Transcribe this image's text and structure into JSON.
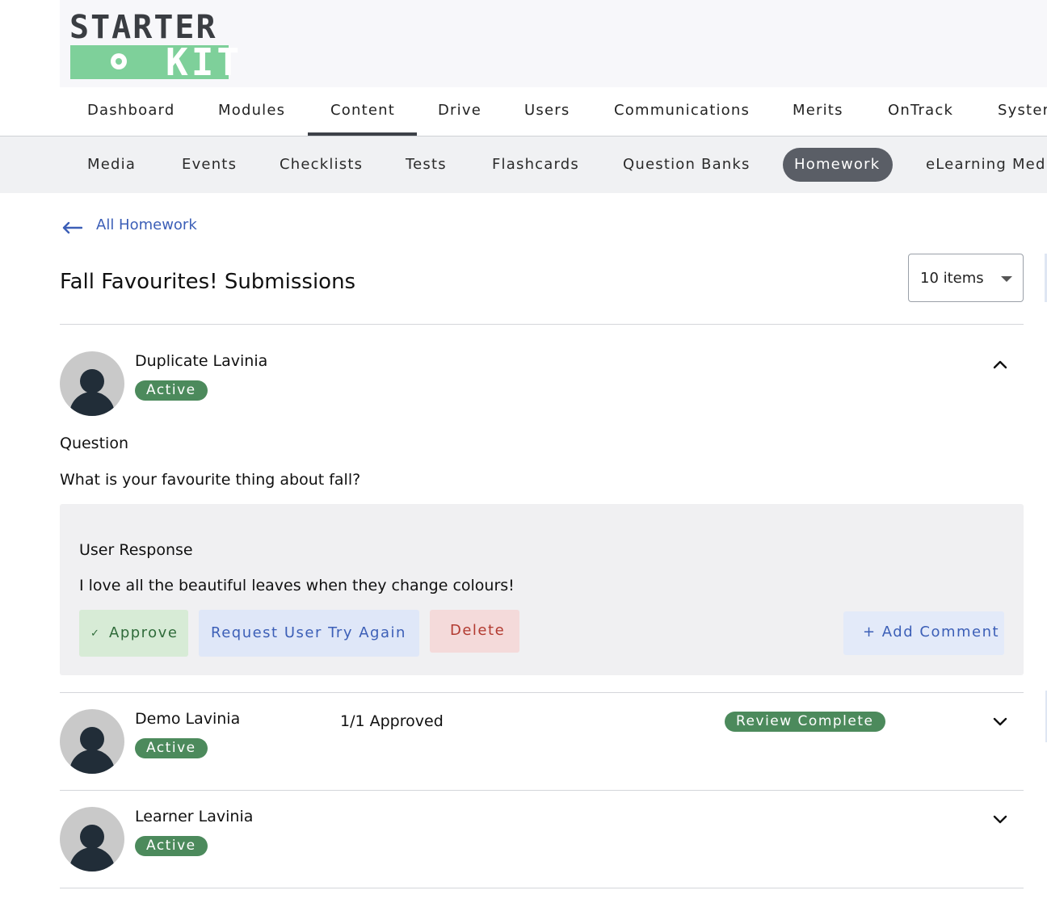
{
  "logo": {
    "line1": "STARTER",
    "line2": "KIT",
    "accent": "#7ed09a"
  },
  "main_nav": {
    "items": [
      "Dashboard",
      "Modules",
      "Content",
      "Drive",
      "Users",
      "Communications",
      "Merits",
      "OnTrack",
      "System"
    ],
    "active": "Content"
  },
  "sub_nav": {
    "items": [
      "Media",
      "Events",
      "Checklists",
      "Tests",
      "Flashcards",
      "Question Banks",
      "Homework",
      "eLearning Media"
    ],
    "active": "Homework"
  },
  "breadcrumb": {
    "back_label": "All Homework",
    "icon": "arrow-left-icon"
  },
  "page": {
    "title": "Fall Favourites! Submissions"
  },
  "page_size_select": {
    "value": "10 items"
  },
  "submissions": [
    {
      "name": "Duplicate Lavinia",
      "status": "Active",
      "expanded": true,
      "question_label": "Question",
      "question": "What is your favourite thing about fall?",
      "response_label": "User Response",
      "response": "I love all the beautiful leaves when they change colours!",
      "actions": {
        "approve": "Approve",
        "retry": "Request User Try Again",
        "delete": "Delete",
        "comment": "+ Add Comment"
      }
    },
    {
      "name": "Demo Lavinia",
      "status": "Active",
      "expanded": false,
      "approved": "1/1 Approved",
      "review_status": "Review Complete"
    },
    {
      "name": "Learner Lavinia",
      "status": "Active",
      "expanded": false
    }
  ],
  "colors": {
    "status_green": "#4c8a5c",
    "link_blue": "#3c5fb7",
    "delete_red": "#b23a30",
    "nav_active": "#5a5e66"
  }
}
